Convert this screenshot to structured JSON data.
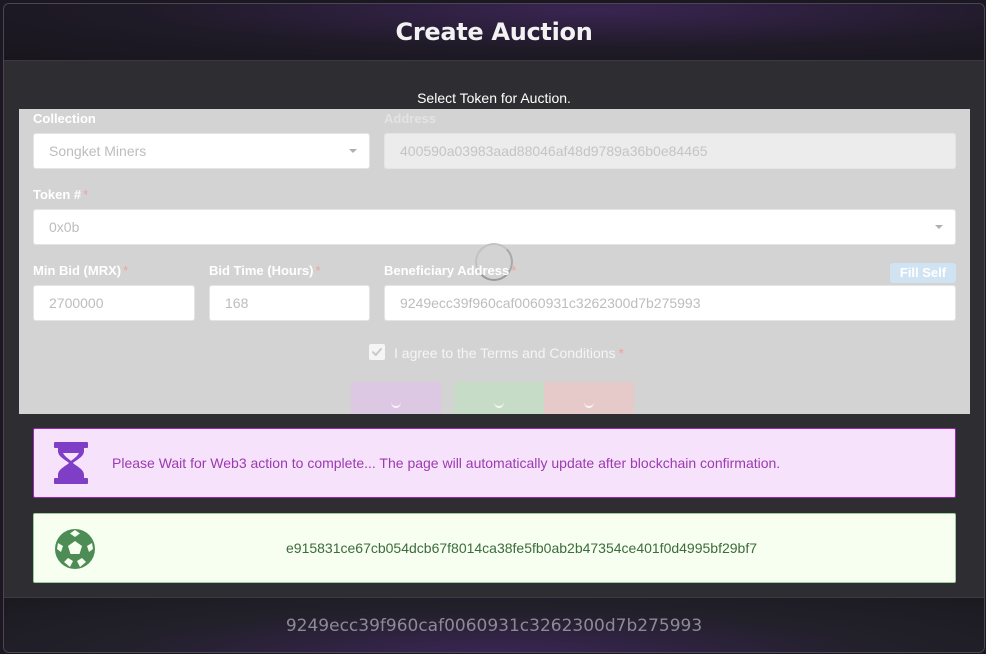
{
  "header": {
    "title": "Create Auction"
  },
  "form": {
    "subtitle": "Select Token for Auction.",
    "collection": {
      "label": "Collection",
      "value": "Songket Miners"
    },
    "address": {
      "label": "Address",
      "value": "400590a03983aad88046af48d9789a36b0e84465"
    },
    "token": {
      "label": "Token #",
      "required_mark": "*",
      "value": "0x0b"
    },
    "min_bid": {
      "label": "Min Bid (MRX)",
      "required_mark": "*",
      "value": "2700000"
    },
    "bid_time": {
      "label": "Bid Time (Hours)",
      "required_mark": "*",
      "value": "168"
    },
    "beneficiary": {
      "label": "Beneficiary Address",
      "required_mark": "*",
      "value": "9249ecc39f960caf0060931c3262300d7b275993"
    },
    "fill_self_label": "Fill Self",
    "agree": {
      "label": "I agree to the Terms and Conditions",
      "required_mark": "*",
      "checked": true
    },
    "buttons": [
      {
        "name": "submit",
        "color": "#dcc8e3"
      },
      {
        "name": "reset",
        "color": "#c7dcc7"
      },
      {
        "name": "cancel",
        "color": "#e6c9c9"
      }
    ]
  },
  "alerts": {
    "wait": {
      "text": "Please Wait for Web3 action to complete... The page will automatically update after blockchain confirmation.",
      "icon": "hourglass-icon",
      "color": "#9c27b0"
    },
    "success": {
      "text": "e915831ce67cb054dcb67f8014ca38fe5fb0ab2b47354ce401f0d4995bf29bf7",
      "icon": "soccer-ball-icon",
      "color": "#4caf50"
    }
  },
  "footer": {
    "address": "9249ecc39f960caf0060931c3262300d7b275993"
  }
}
